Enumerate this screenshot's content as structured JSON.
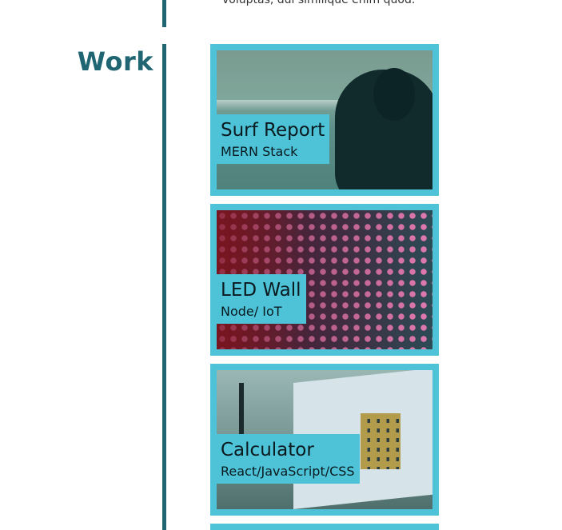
{
  "intro": {
    "tail_text": "voluptas, dui similique enim quod."
  },
  "section": {
    "title": "Work"
  },
  "projects": [
    {
      "title": "Surf Report",
      "stack": "MERN Stack"
    },
    {
      "title": "LED Wall",
      "stack": "Node/ IoT"
    },
    {
      "title": "Calculator",
      "stack": "React/JavaScript/CSS"
    }
  ],
  "colors": {
    "accent": "#4ec3d8",
    "divider": "#1f6672",
    "title": "#1f6672"
  }
}
